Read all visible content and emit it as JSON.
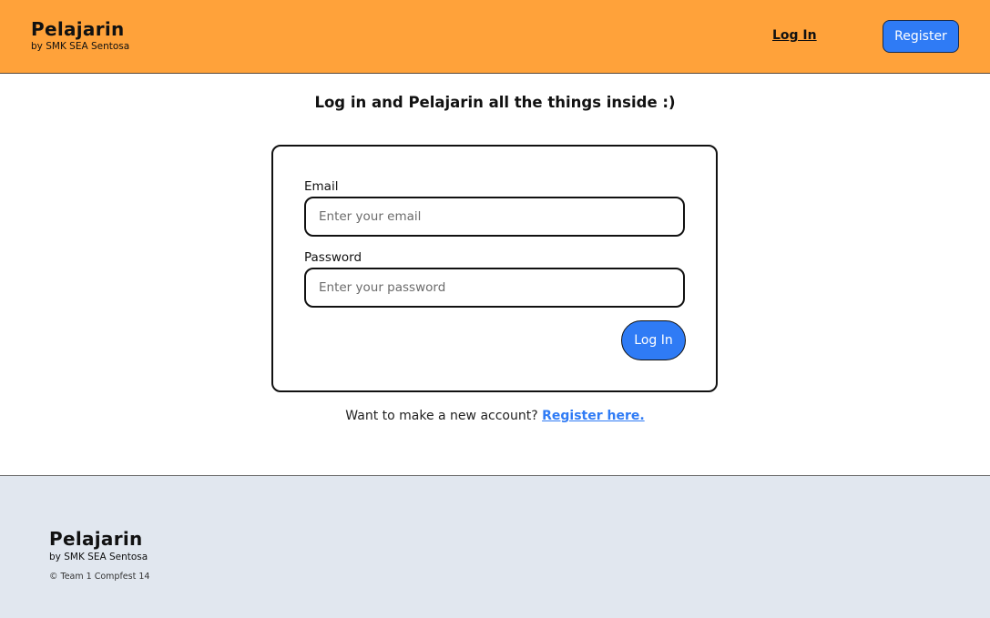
{
  "header": {
    "brand_title": "Pelajarin",
    "brand_subtitle": "by SMK SEA Sentosa",
    "login_link": "Log In",
    "register_button": "Register"
  },
  "main": {
    "heading": "Log in and Pelajarin all the things inside :)",
    "form": {
      "email_label": "Email",
      "email_placeholder": "Enter your email",
      "email_value": "",
      "password_label": "Password",
      "password_placeholder": "Enter your password",
      "password_value": "",
      "submit_label": "Log In"
    },
    "register_prompt": "Want to make a new account?",
    "register_link": "Register here."
  },
  "footer": {
    "brand_title": "Pelajarin",
    "brand_subtitle": "by SMK SEA Sentosa",
    "copyright": "© Team 1 Compfest 14"
  },
  "colors": {
    "header_bg": "#ffa23a",
    "accent_blue": "#2f7bf5",
    "footer_bg": "#e1e7ef"
  }
}
